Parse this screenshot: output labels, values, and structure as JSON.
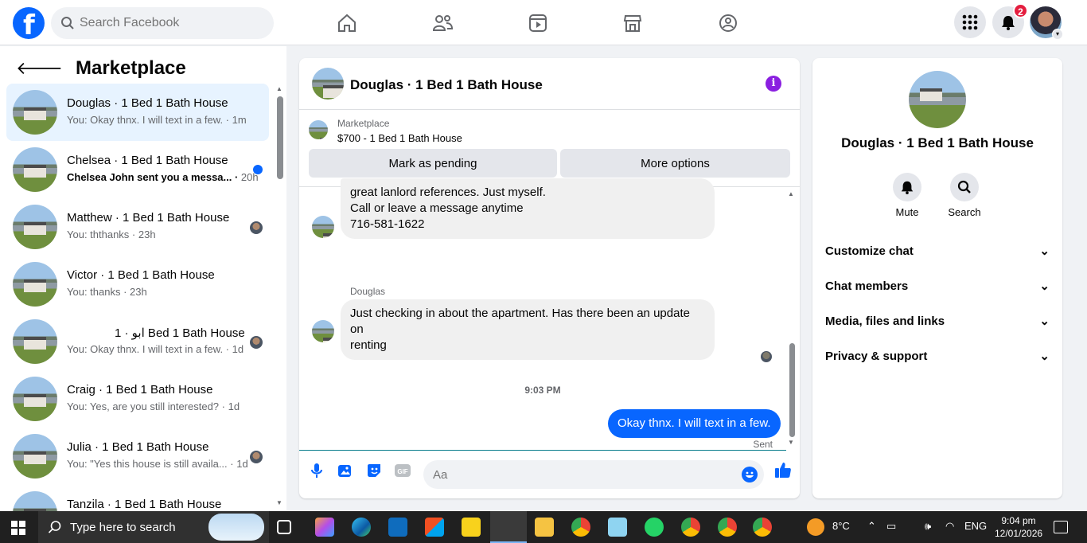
{
  "top_nav": {
    "search_placeholder": "Search Facebook",
    "notification_count": "2"
  },
  "sidebar": {
    "title": "Marketplace",
    "conversations": [
      {
        "title": "Douglas · 1 Bed 1 Bath House",
        "preview": "You: Okay thnx. I will text in a few.",
        "time": "1m"
      },
      {
        "title": "Chelsea · 1 Bed 1 Bath House",
        "preview": "Chelsea John sent you a messa...",
        "time": "20h"
      },
      {
        "title": "Matthew · 1 Bed 1 Bath House",
        "preview": "You: ththanks",
        "time": "23h"
      },
      {
        "title": "Victor · 1 Bed 1 Bath House",
        "preview": "You: thanks",
        "time": "23h"
      },
      {
        "title": "ابو · 1 Bed 1 Bath House",
        "preview": "You: Okay thnx. I will text in a few.",
        "time": "1d"
      },
      {
        "title": "Craig · 1 Bed 1 Bath House",
        "preview": "You: Yes, are you still interested?",
        "time": "1d"
      },
      {
        "title": "Julia · 1 Bed 1 Bath House",
        "preview": "You: \"Yes this house is still availa...",
        "time": "1d"
      },
      {
        "title": "Tanzila · 1 Bed 1 Bath House",
        "preview": "",
        "time": ""
      }
    ]
  },
  "chat": {
    "title": "Douglas · 1 Bed 1 Bath House",
    "marketplace_label": "Marketplace",
    "listing": "$700 - 1 Bed 1 Bath House",
    "mark_pending_label": "Mark as pending",
    "more_options_label": "More options",
    "msg1_line1": "great lanlord references. Just myself.",
    "msg1_line2": "Call or leave a message anytime",
    "msg1_line3": "716-581-1622",
    "msg2_sender": "Douglas",
    "msg2_line1": "Just checking in about the apartment. Has there been an update on",
    "msg2_line2": "renting",
    "time_separator": "9:03 PM",
    "outgoing": "Okay thnx. I will text in a few.",
    "status": "Sent",
    "composer_placeholder": "Aa"
  },
  "right_panel": {
    "title": "Douglas · 1 Bed 1 Bath House",
    "mute_label": "Mute",
    "search_label": "Search",
    "rows": [
      "Customize chat",
      "Chat members",
      "Media, files and links",
      "Privacy & support"
    ]
  },
  "taskbar": {
    "search_label": "Type here to search",
    "weather": "8°C",
    "language": "ENG",
    "time": "9:04 pm",
    "date": "12/01/2026"
  },
  "colors": {
    "brand": "#0866ff",
    "info_icon": "#8a1fe0",
    "badge": "#e41e3f"
  }
}
